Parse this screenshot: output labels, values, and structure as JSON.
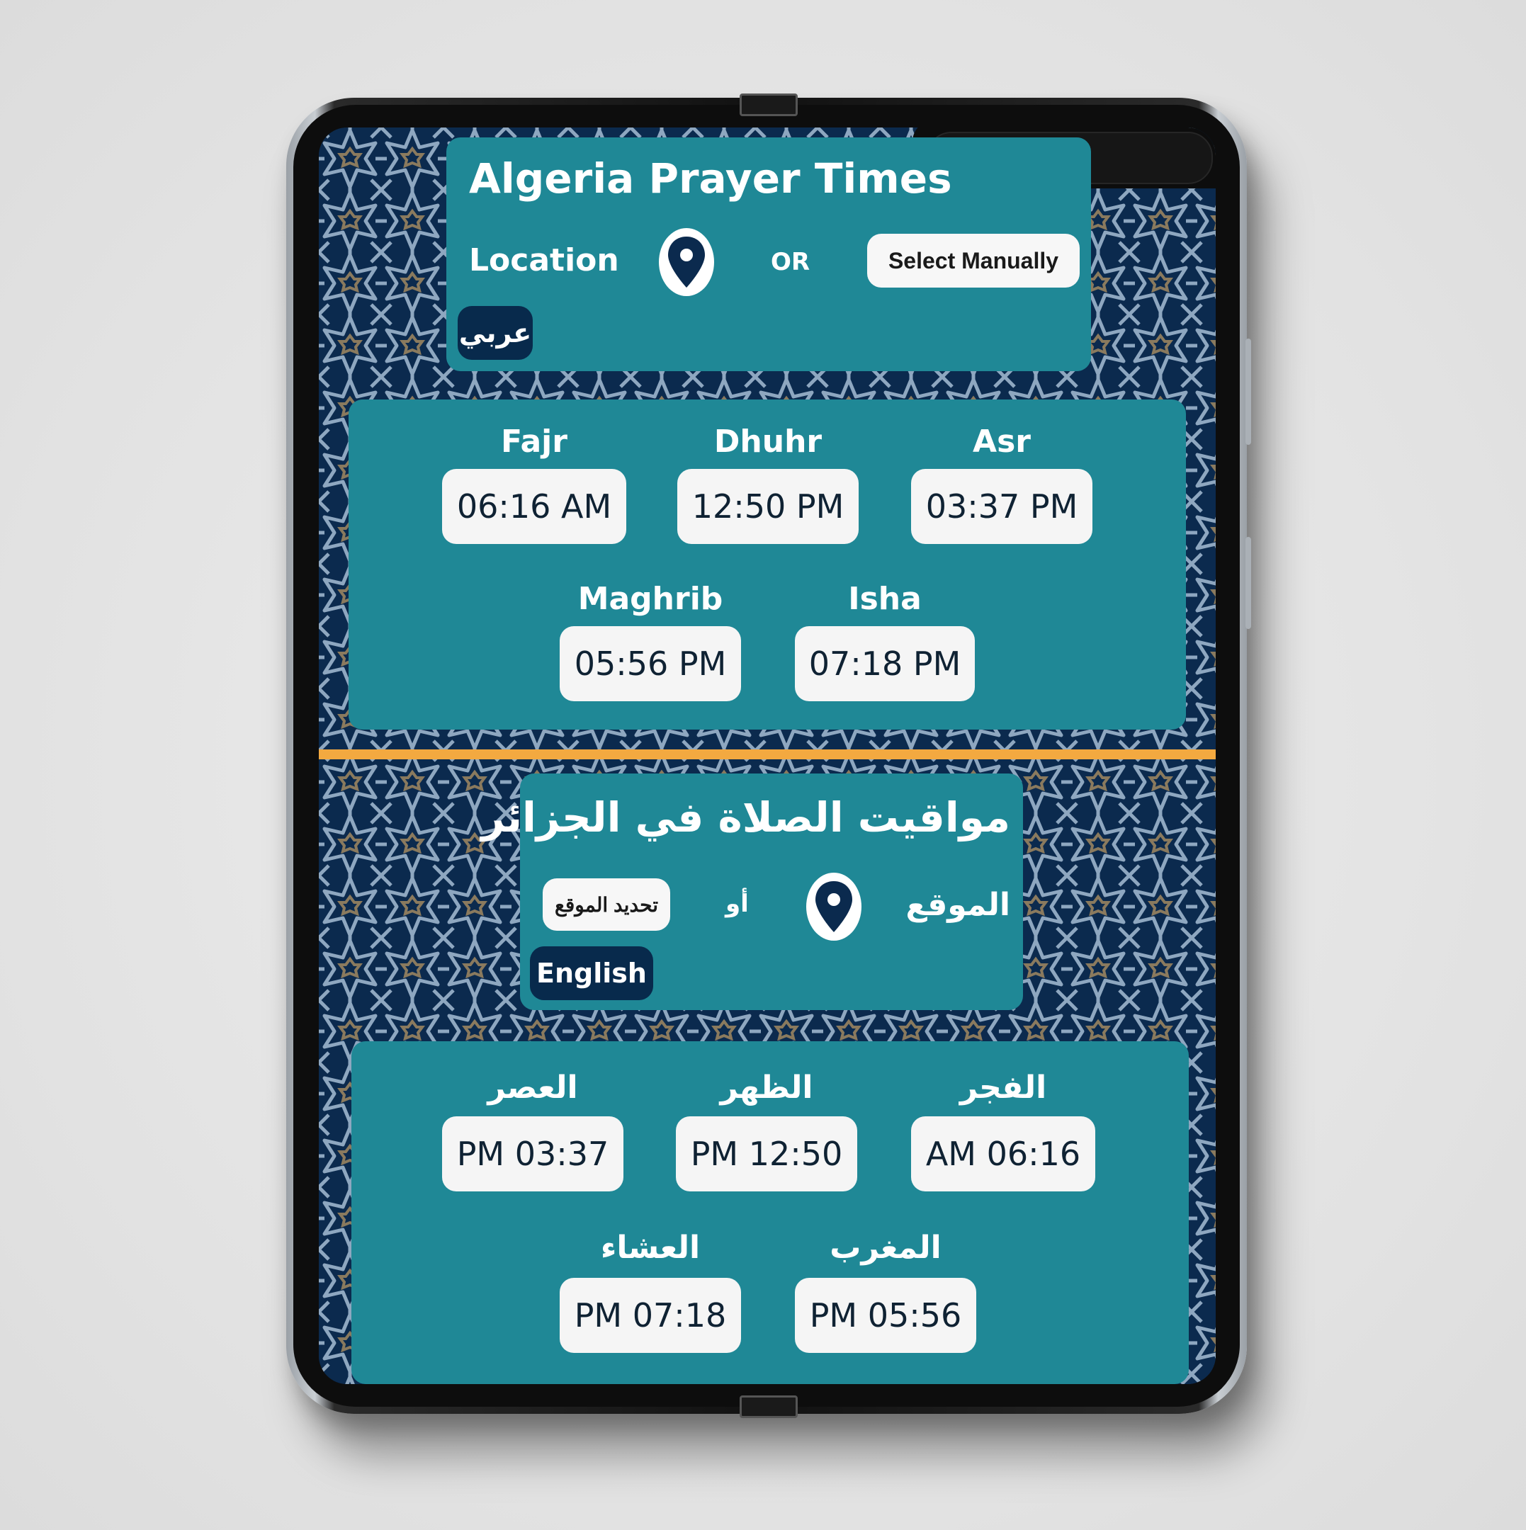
{
  "english": {
    "title": "Algeria Prayer Times",
    "location_label": "Location",
    "or_label": "OR",
    "select_manually": "Select Manually",
    "language_toggle": "عربي",
    "prayers": [
      {
        "name": "Fajr",
        "time": "06:16 AM"
      },
      {
        "name": "Dhuhr",
        "time": "12:50 PM"
      },
      {
        "name": "Asr",
        "time": "03:37 PM"
      },
      {
        "name": "Maghrib",
        "time": "05:56 PM"
      },
      {
        "name": "Isha",
        "time": "07:18 PM"
      }
    ]
  },
  "arabic": {
    "title": "مواقيت الصلاة في الجزائر",
    "location_label": "الموقع",
    "or_label": "أو",
    "select_manually": "تحديد الموقع",
    "language_toggle": "English",
    "prayers": [
      {
        "name": "الفجر",
        "time": "AM 06:16"
      },
      {
        "name": "الظهر",
        "time": "PM 12:50"
      },
      {
        "name": "العصر",
        "time": "PM 03:37"
      },
      {
        "name": "المغرب",
        "time": "PM 05:56"
      },
      {
        "name": "العشاء",
        "time": "PM 07:18"
      }
    ]
  },
  "icons": {
    "location": "map-pin-icon"
  },
  "colors": {
    "panel": "#1f8896",
    "background": "#0b2a4e",
    "divider": "#f3a940",
    "dark_button": "#082a4c",
    "time_box": "#f5f5f5"
  }
}
